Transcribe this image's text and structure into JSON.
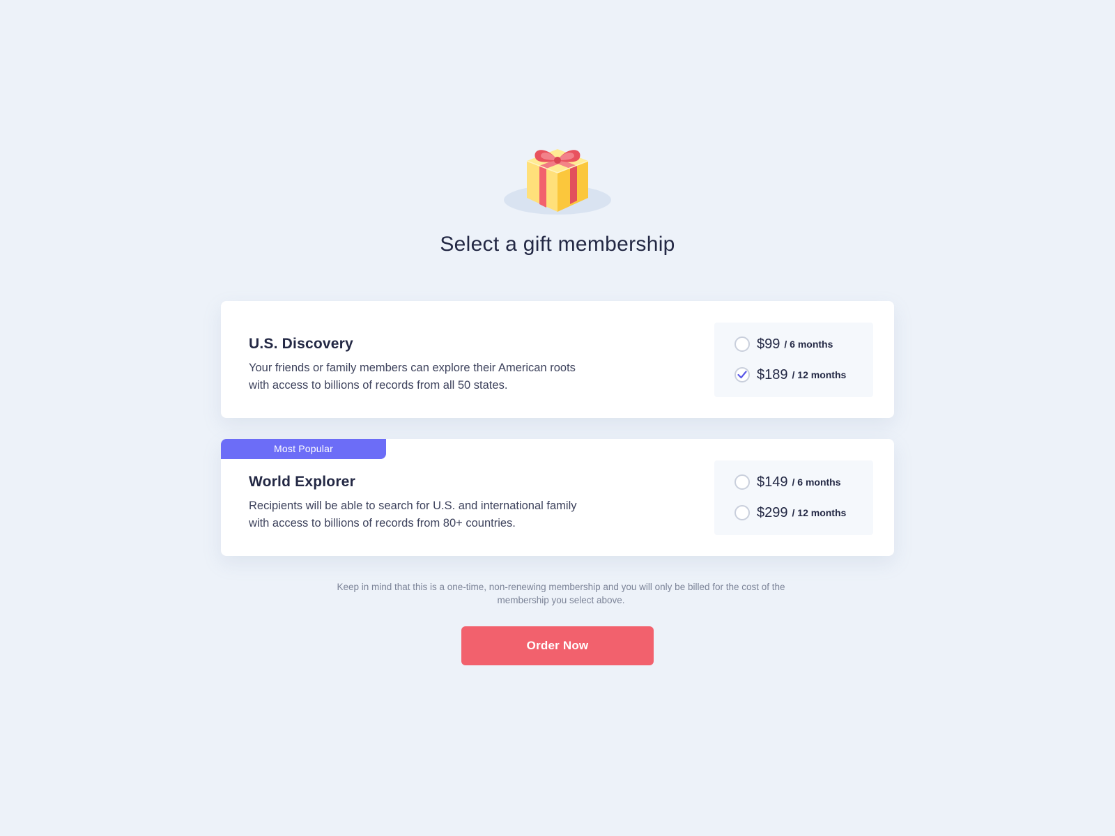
{
  "header": {
    "icon": "gift-icon",
    "title": "Select a gift membership"
  },
  "plans": [
    {
      "name": "U.S. Discovery",
      "description": "Your friends or family members can explore their American roots with access to billions of records from all 50 states.",
      "badge": "",
      "options": [
        {
          "price": "$99",
          "period": "/ 6 months",
          "selected": false
        },
        {
          "price": "$189",
          "period": "/ 12 months",
          "selected": true
        }
      ]
    },
    {
      "name": "World Explorer",
      "description": "Recipients will be able to search for U.S. and international family with access to billions of records from 80+ countries.",
      "badge": "Most Popular",
      "options": [
        {
          "price": "$149",
          "period": "/ 6 months",
          "selected": false
        },
        {
          "price": "$299",
          "period": "/ 12 months",
          "selected": false
        }
      ]
    }
  ],
  "note": "Keep in mind that this is a one-time, non-renewing membership and you will only be billed for the cost of the membership you select above.",
  "order_button": {
    "label": "Order Now"
  },
  "colors": {
    "background": "#edf2f9",
    "accent": "#6c6df7",
    "cta": "#f2616d",
    "text": "#232844"
  }
}
